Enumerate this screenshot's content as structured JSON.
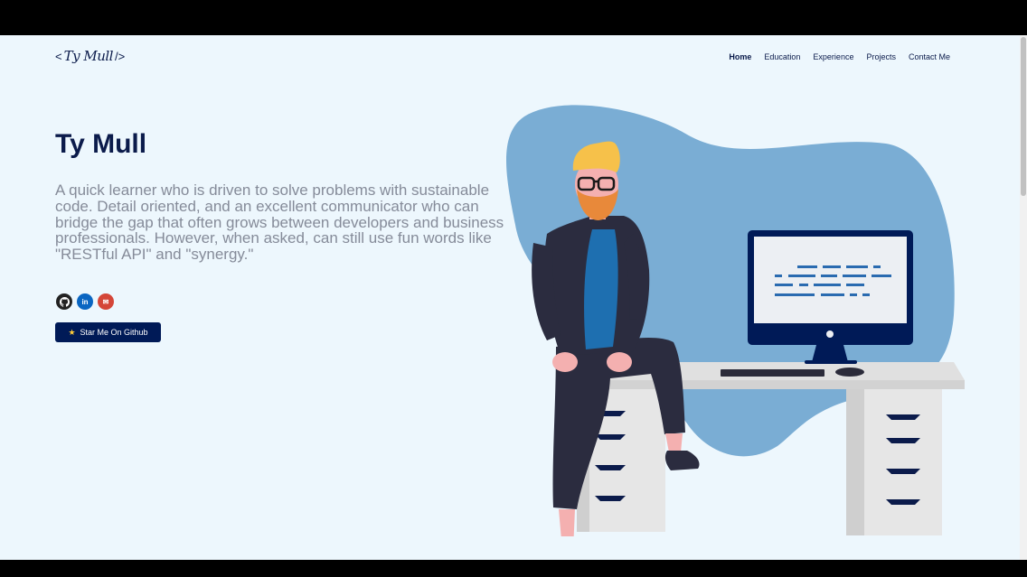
{
  "header": {
    "logo": {
      "open": "<",
      "signature": "Ty Mull",
      "close": "/>"
    },
    "nav": [
      {
        "label": "Home",
        "active": true
      },
      {
        "label": "Education",
        "active": false
      },
      {
        "label": "Experience",
        "active": false
      },
      {
        "label": "Projects",
        "active": false
      },
      {
        "label": "Contact Me",
        "active": false
      }
    ]
  },
  "hero": {
    "name": "Ty Mull",
    "bio": "A quick learner who is driven to solve problems with sustainable code. Detail oriented, and an excellent communicator who can bridge the gap that often grows between developers and business professionals. However, when asked, can still use fun words like \"RESTful API\" and \"synergy.\"",
    "socials": [
      {
        "icon": "github-icon"
      },
      {
        "icon": "linkedin-icon",
        "text": "in"
      },
      {
        "icon": "gmail-icon",
        "text": "✉"
      }
    ],
    "star_button": {
      "icon": "★",
      "label": "Star Me On Github"
    }
  },
  "colors": {
    "background": "#edf7fd",
    "primary": "#0b1b4b",
    "button": "#001a57",
    "blob": "#7aadd4",
    "text_muted": "#858b99"
  }
}
